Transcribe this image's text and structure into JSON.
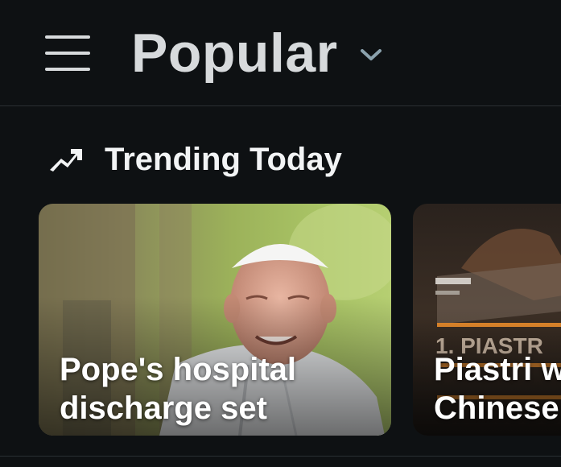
{
  "header": {
    "title": "Popular",
    "menu_icon": "hamburger-menu-icon",
    "dropdown_icon": "chevron-down-icon"
  },
  "section": {
    "title": "Trending Today",
    "icon": "trending-arrow-icon"
  },
  "cards": [
    {
      "headline": "Pope's hospital\ndischarge set"
    },
    {
      "headline_line1": "Piastri w",
      "headline_line2": "Chinese"
    }
  ],
  "colors": {
    "background": "#0e1113",
    "title": "#d7dadc",
    "text": "#f2f4f5",
    "divider": "#2a2f33",
    "chevron": "#8ba2ad"
  }
}
